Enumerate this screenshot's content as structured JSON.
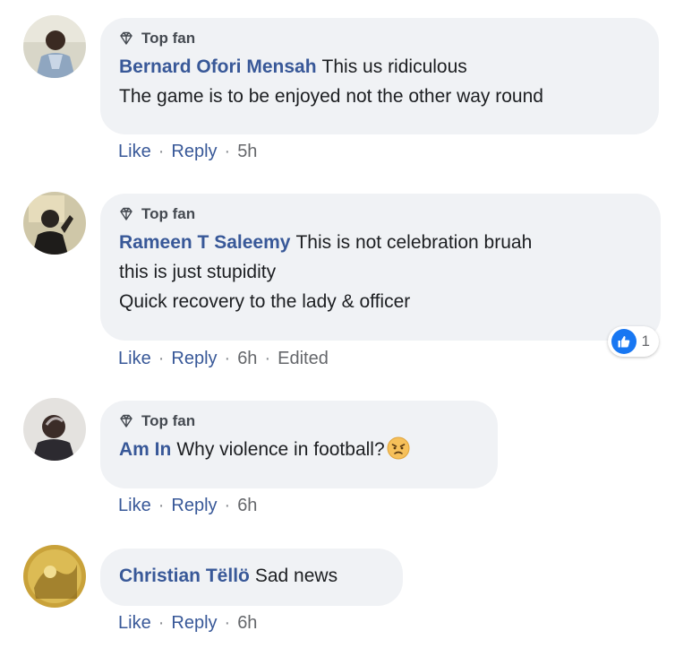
{
  "comments": [
    {
      "badge": "Top fan",
      "author": "Bernard Ofori Mensah",
      "lines": [
        "This us ridiculous",
        "The game is to be enjoyed not the other way round"
      ],
      "like": "Like",
      "reply": "Reply",
      "time": "5h"
    },
    {
      "badge": "Top fan",
      "author": "Rameen T Saleemy",
      "lines": [
        "This is not celebration bruah",
        "this is just stupidity",
        "Quick recovery to the lady & officer"
      ],
      "like": "Like",
      "reply": "Reply",
      "time": "6h",
      "edited": "Edited",
      "reaction_count": "1"
    },
    {
      "badge": "Top fan",
      "author": "Am In",
      "lines": [
        "Why violence in football?"
      ],
      "like": "Like",
      "reply": "Reply",
      "time": "6h",
      "emoji": "angry-face"
    },
    {
      "author": "Christian Tëllö",
      "lines": [
        "Sad news"
      ],
      "like": "Like",
      "reply": "Reply",
      "time": "6h"
    }
  ],
  "colors": {
    "name": "#385898",
    "bubble": "#f0f2f5",
    "meta": "#65676b",
    "like_blue": "#1877f2"
  }
}
